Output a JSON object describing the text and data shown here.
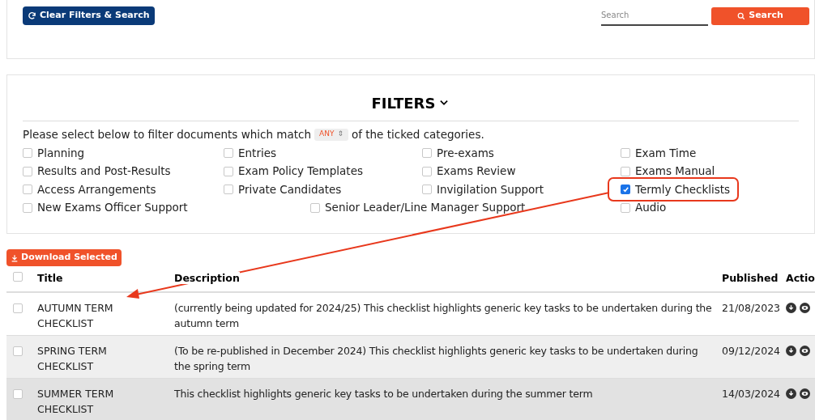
{
  "toolbar": {
    "clear_button": "Clear Filters & Search",
    "search": {
      "placeholder": "Search"
    },
    "search_button": "Search"
  },
  "filters": {
    "title": "FILTERS",
    "expanded": true,
    "intro_before": "Please select below to filter documents which match",
    "match_mode": "ANY",
    "match_mode_arrows": "⇕",
    "intro_after": "of the ticked categories.",
    "categories": [
      {
        "label": "Planning",
        "checked": false
      },
      {
        "label": "Entries",
        "checked": false
      },
      {
        "label": "Pre-exams",
        "checked": false
      },
      {
        "label": "Exam Time",
        "checked": false
      },
      {
        "label": "Results and Post-Results",
        "checked": false
      },
      {
        "label": "Exam Policy Templates",
        "checked": false
      },
      {
        "label": "Exams Review",
        "checked": false
      },
      {
        "label": "Exams Manual",
        "checked": false
      },
      {
        "label": "Access Arrangements",
        "checked": false
      },
      {
        "label": "Private Candidates",
        "checked": false
      },
      {
        "label": "Invigilation Support",
        "checked": false
      },
      {
        "label": "Termly Checklists",
        "checked": true
      },
      {
        "label": "New Exams Officer Support",
        "checked": false
      },
      {
        "label": "Senior Leader/Line Manager Support",
        "checked": false
      },
      {
        "label": "Audio",
        "checked": false
      }
    ]
  },
  "download_button": "Download Selected",
  "table": {
    "select_all": {
      "checked": false
    },
    "columns": [
      "Title",
      "Description",
      "Published",
      "Actio"
    ],
    "rows": [
      {
        "title": "AUTUMN TERM CHECKLIST",
        "description": "(currently being updated for 2024/25) This checklist highlights generic key tasks to be undertaken during the autumn term",
        "published": "21/08/2023",
        "checked": false,
        "hovered": false
      },
      {
        "title": "SPRING TERM CHECKLIST",
        "description": "(To be re-published in December 2024) This checklist highlights generic key tasks to be undertaken during the spring term",
        "published": "09/12/2024",
        "checked": false,
        "hovered": false
      },
      {
        "title": "SUMMER TERM CHECKLIST",
        "description": "This checklist highlights generic key tasks to be undertaken during the summer term",
        "published": "14/03/2024",
        "checked": false,
        "hovered": true
      }
    ]
  }
}
